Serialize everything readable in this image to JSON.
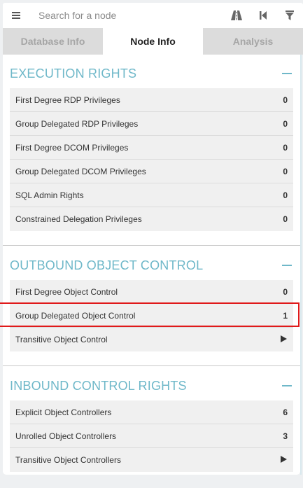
{
  "search": {
    "placeholder": "Search for a node",
    "menu_icon": "hamburger-menu-icon",
    "tools": [
      "pathfinding-road-icon",
      "back-step-icon",
      "filter-icon"
    ]
  },
  "tabs": [
    {
      "label": "Database Info",
      "active": false
    },
    {
      "label": "Node Info",
      "active": true
    },
    {
      "label": "Analysis",
      "active": false
    }
  ],
  "sections": {
    "execution": {
      "title": "EXECUTION RIGHTS",
      "rows": [
        {
          "label": "First Degree RDP Privileges",
          "value": "0"
        },
        {
          "label": "Group Delegated RDP Privileges",
          "value": "0"
        },
        {
          "label": "First Degree DCOM Privileges",
          "value": "0"
        },
        {
          "label": "Group Delegated DCOM Privileges",
          "value": "0"
        },
        {
          "label": "SQL Admin Rights",
          "value": "0"
        },
        {
          "label": "Constrained Delegation Privileges",
          "value": "0"
        }
      ]
    },
    "outbound": {
      "title": "OUTBOUND OBJECT CONTROL",
      "rows": [
        {
          "label": "First Degree Object Control",
          "value": "0"
        },
        {
          "label": "Group Delegated Object Control",
          "value": "1"
        },
        {
          "label": "Transitive Object Control",
          "value": null
        }
      ]
    },
    "inbound": {
      "title": "INBOUND CONTROL RIGHTS",
      "rows": [
        {
          "label": "Explicit Object Controllers",
          "value": "6"
        },
        {
          "label": "Unrolled Object Controllers",
          "value": "3"
        },
        {
          "label": "Transitive Object Controllers",
          "value": null
        }
      ]
    }
  },
  "colors": {
    "section_title": "#6fb8c9",
    "highlight_border": "#e0191a"
  }
}
